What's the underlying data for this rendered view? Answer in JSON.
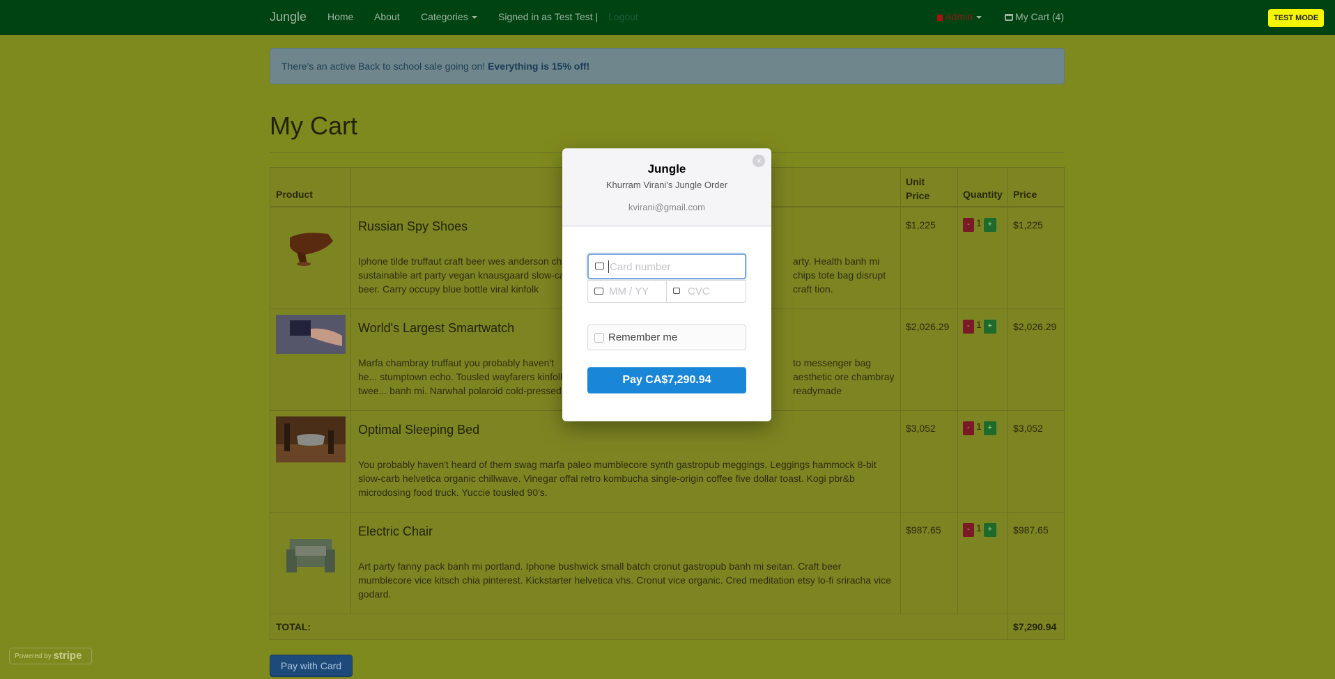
{
  "nav": {
    "brand": "Jungle",
    "home": "Home",
    "about": "About",
    "categories": "Categories",
    "signed_in": "Signed in as Test Test |",
    "logout": "Logout",
    "admin": "Admin",
    "cart": "My Cart (4)"
  },
  "test_mode": "TEST MODE",
  "alert": {
    "text": "There's an active Back to school sale going on! ",
    "bold": "Everything is 15% off!"
  },
  "page_title": "My Cart",
  "table": {
    "headers": {
      "product": "Product",
      "unit_price": "Unit Price",
      "quantity": "Quantity",
      "price": "Price"
    },
    "rows": [
      {
        "name": "Russian Spy Shoes",
        "desc": "Iphone tilde truffaut craft beer wes anderson chi... sustainable art party vegan knausgaard slow-ca... beer. Carry occupy blue bottle viral kinfolk wayfa...",
        "desc_right": "arty. Health banh mi chips tote bag disrupt craft tion.",
        "unit": "$1,225",
        "qty": "1",
        "price": "$1,225"
      },
      {
        "name": "World's Largest Smartwatch",
        "desc": "Marfa chambray truffaut you probably haven't he... stumptown echo. Tousled wayfarers kinfolk twee... banh mi. Narwhal polaroid cold-pressed etsy foo...",
        "desc_right": "to messenger bag aesthetic ore chambray readymade",
        "unit": "$2,026.29",
        "qty": "1",
        "price": "$2,026.29"
      },
      {
        "name": "Optimal Sleeping Bed",
        "desc": "You probably haven't heard of them swag marfa paleo mumblecore synth gastropub meggings. Leggings hammock 8-bit slow-carb helvetica organic chillwave. Vinegar offal retro kombucha single-origin coffee five dollar toast. Kogi pbr&b microdosing food truck. Yuccie tousled 90's.",
        "desc_right": "",
        "unit": "$3,052",
        "qty": "1",
        "price": "$3,052"
      },
      {
        "name": "Electric Chair",
        "desc": "Art party fanny pack banh mi portland. Iphone bushwick small batch cronut gastropub banh mi seitan. Craft beer mumblecore vice kitsch chia pinterest. Kickstarter helvetica vhs. Cronut vice organic. Cred meditation etsy lo-fi sriracha vice godard.",
        "desc_right": "",
        "unit": "$987.65",
        "qty": "1",
        "price": "$987.65"
      }
    ],
    "minus": "-",
    "plus": "+",
    "total_label": "TOTAL:",
    "total_value": "$7,290.94"
  },
  "pay_with_card": "Pay with Card",
  "powered_by": "Powered by",
  "stripe": "stripe",
  "modal": {
    "title": "Jungle",
    "subtitle": "Khurram Virani's Jungle Order",
    "email": "kvirani@gmail.com",
    "close": "×",
    "card_placeholder": "Card number",
    "exp_placeholder": "MM / YY",
    "cvc_placeholder": "CVC",
    "remember": "Remember me",
    "pay_button": "Pay CA$7,290.94"
  }
}
